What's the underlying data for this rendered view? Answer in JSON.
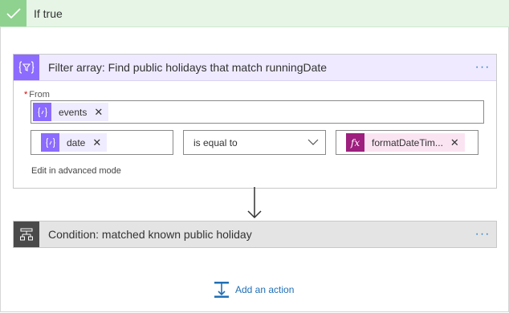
{
  "branch": {
    "label": "If true"
  },
  "filter_action": {
    "title": "Filter array: Find public holidays that match runningDate",
    "menu": "···",
    "from": {
      "required_marker": "*",
      "label": "From",
      "token": {
        "label": "events",
        "icon": "dynamic-content-icon"
      }
    },
    "condition_row": {
      "left_token": {
        "label": "date",
        "icon": "dynamic-content-icon"
      },
      "operator": "is equal to",
      "right_token": {
        "label": "formatDateTim...",
        "icon": "expression-fx-icon"
      }
    },
    "advanced_mode": "Edit in advanced mode"
  },
  "condition_action": {
    "title": "Condition: matched known public holiday",
    "menu": "···"
  },
  "add_action": {
    "label": "Add an action"
  },
  "colors": {
    "branch_bg": "#e6f5e6",
    "branch_check": "#8fd18f",
    "filter_accent": "#8c6cff",
    "expression_accent": "#9d1f7e",
    "condition_accent": "#4a4a4a",
    "link": "#1f6fb5"
  }
}
